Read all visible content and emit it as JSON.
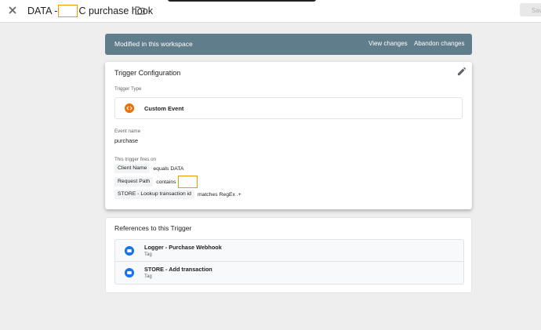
{
  "header": {
    "title_prefix": "DATA -",
    "title_suffix": "C purchase hook",
    "save_label": "Save"
  },
  "banner": {
    "message": "Modified in this workspace",
    "view_changes": "View changes",
    "abandon_changes": "Abandon changes"
  },
  "trigger_config": {
    "title": "Trigger Configuration",
    "trigger_type_label": "Trigger Type",
    "trigger_type": "Custom Event",
    "event_name_label": "Event name",
    "event_name": "purchase",
    "fires_on_label": "This trigger fires on",
    "conditions": [
      {
        "variable": "Client Name",
        "operator": "equals DATA",
        "value": ""
      },
      {
        "variable": "Request Path",
        "operator": "contains",
        "value": ""
      },
      {
        "variable": "STORE - Lookup transaction id",
        "operator": "matches RegEx .+",
        "value": ""
      }
    ]
  },
  "references": {
    "title": "References to this Trigger",
    "items": [
      {
        "name": "Logger - Purchase Webhook",
        "type": "Tag"
      },
      {
        "name": "STORE - Add transaction",
        "type": "Tag"
      }
    ]
  },
  "colors": {
    "banner": "#607d8b",
    "custom_event_icon": "#e8710a",
    "tag_icon": "#1a73e8",
    "redaction_outline": "#f29900"
  },
  "icons": {
    "close": "close-icon",
    "folder": "folder-icon",
    "edit": "pencil-icon",
    "custom_event": "custom-event-icon",
    "tag": "tag-icon"
  }
}
